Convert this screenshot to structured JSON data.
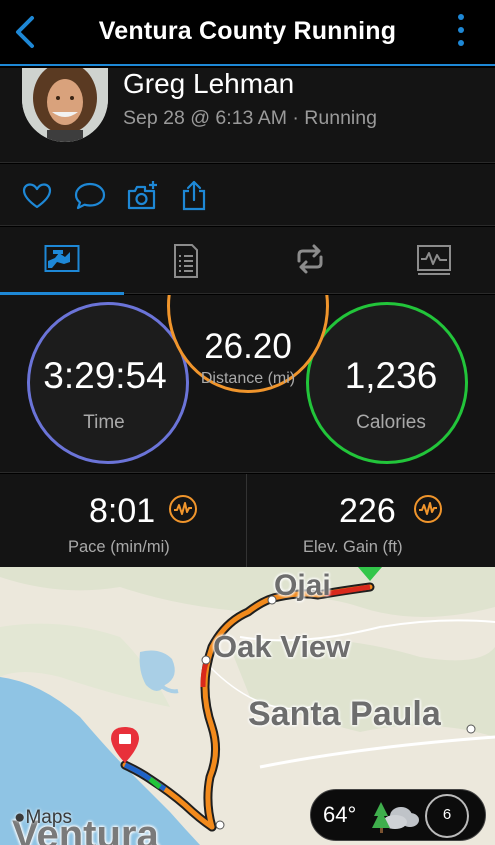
{
  "header": {
    "title": "Ventura County Running",
    "back_icon": "chevron-left-icon",
    "menu_icon": "kebab-menu-icon"
  },
  "profile": {
    "name": "Greg Lehman",
    "meta": "Sep 28 @ 6:13 AM · Running"
  },
  "actions": [
    {
      "icon": "heart-icon"
    },
    {
      "icon": "comment-icon"
    },
    {
      "icon": "add-photo-icon"
    },
    {
      "icon": "share-icon"
    }
  ],
  "tabs": [
    {
      "icon": "summary-icon",
      "active": true
    },
    {
      "icon": "details-list-icon",
      "active": false
    },
    {
      "icon": "laps-icon",
      "active": false
    },
    {
      "icon": "charts-icon",
      "active": false
    }
  ],
  "stats": {
    "time": {
      "value": "3:29:54",
      "label": "Time"
    },
    "distance": {
      "value": "26.20",
      "label": "Distance (mi)"
    },
    "calories": {
      "value": "1,236",
      "label": "Calories"
    }
  },
  "metrics": {
    "pace": {
      "value": "8:01",
      "label": "Pace (min/mi)"
    },
    "elevation": {
      "value": "226",
      "label": "Elev. Gain (ft)"
    }
  },
  "map": {
    "places": {
      "ojai": "Ojai",
      "oak_view": "Oak View",
      "santa_paula": "Santa Paula",
      "ventura": "Ventura"
    },
    "attribution": "Maps",
    "weather": {
      "temperature": "64°",
      "icon": "partly-cloudy-trees-icon",
      "aqi": "6"
    }
  },
  "colors": {
    "accent": "#1e88d6",
    "time_ring": "#6b74d8",
    "distance_ring": "#f0952c",
    "calories_ring": "#22c53a",
    "route": "#f28a1c",
    "route_fast": "#d9291c",
    "route_slow": "#1f63c8"
  }
}
